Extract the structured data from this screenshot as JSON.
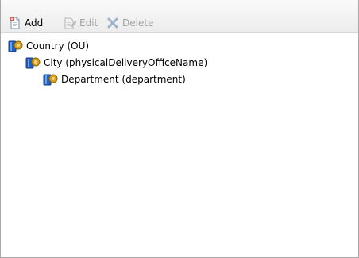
{
  "toolbar": {
    "add_label": "Add",
    "edit_label": "Edit",
    "delete_label": "Delete",
    "add_enabled": true,
    "edit_enabled": false,
    "delete_enabled": false
  },
  "tree": {
    "nodes": [
      {
        "label": "Country (OU)",
        "level": 0,
        "icon": "ou-book-icon"
      },
      {
        "label": "City (physicalDeliveryOfficeName)",
        "level": 1,
        "icon": "ou-book-icon"
      },
      {
        "label": "Department (department)",
        "level": 2,
        "icon": "ou-book-icon"
      }
    ]
  },
  "colors": {
    "disabled_text": "#a3a3a3",
    "toolbar_gradient_top": "#fafafa",
    "toolbar_gradient_bottom": "#ececec",
    "border": "#a9a9a9",
    "book_blue": "#1f5fbf",
    "book_gold": "#d7a11a",
    "delete_x": "#9fb3c8"
  }
}
